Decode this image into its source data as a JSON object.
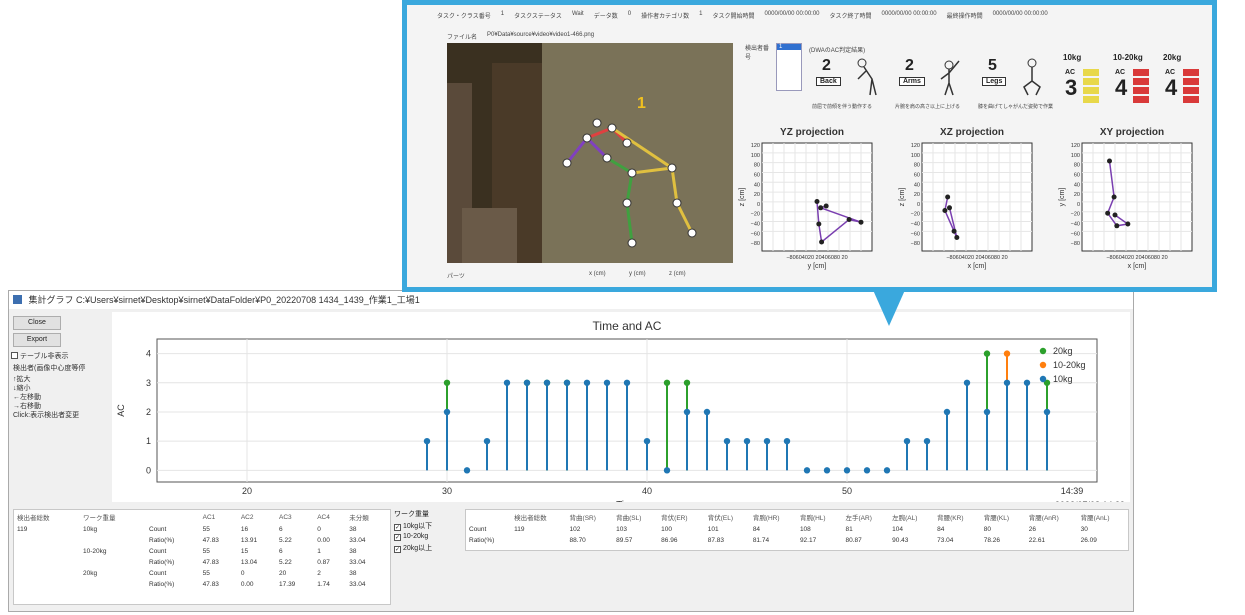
{
  "window": {
    "title": "集計グラフ C:¥Users¥sirnet¥Desktop¥sirnet¥DataFolder¥P0_20220708 1434_1439_作業1_工場1"
  },
  "sidebar": {
    "close_label": "Close",
    "export_label": "Export",
    "table_toggle_label": "テーブル非表示",
    "options_title": "検出者(画像中心度等停",
    "opt_zoom_in": "↑拡大",
    "opt_zoom_out": "↓縮小",
    "opt_move_left": "←左移動",
    "opt_move_right": "→右移動",
    "opt_click": "Click:表示検出者変更"
  },
  "chart_data": {
    "type": "scatter",
    "title": "Time and AC",
    "xlabel": "Time",
    "ylabel": "AC",
    "xlim": [
      15.5,
      62.5
    ],
    "ylim": [
      -0.4,
      4.5
    ],
    "xticks": [
      20,
      30,
      40,
      50
    ],
    "yticks": [
      0,
      1,
      2,
      3,
      4
    ],
    "extra_xtick_label": "14:39",
    "date_label": "2022/07/08 14:39",
    "legend_position": "top-right",
    "series": [
      {
        "name": "20kg",
        "color": "#2ca02c",
        "x": [
          30,
          34,
          35,
          36,
          41,
          42,
          57,
          60
        ],
        "y": [
          3,
          3,
          3,
          3,
          3,
          3,
          4,
          3
        ]
      },
      {
        "name": "10-20kg",
        "color": "#ff7f0e",
        "x": [
          58
        ],
        "y": [
          4
        ]
      },
      {
        "name": "10kg",
        "color": "#1f77b4",
        "x": [
          29,
          30,
          31,
          32,
          33,
          34,
          35,
          36,
          37,
          38,
          39,
          40,
          41,
          42,
          43,
          44,
          45,
          46,
          47,
          48,
          49,
          50,
          51,
          52,
          53,
          54,
          55,
          56,
          57,
          58,
          59,
          60
        ],
        "y": [
          1,
          2,
          0,
          1,
          3,
          3,
          3,
          3,
          3,
          3,
          3,
          1,
          0,
          2,
          2,
          1,
          1,
          1,
          1,
          0,
          0,
          0,
          0,
          0,
          1,
          1,
          2,
          3,
          2,
          3,
          3,
          2
        ]
      }
    ]
  },
  "stats_table": {
    "headers": [
      "検出者総数",
      "ワーク重量",
      "",
      "AC1",
      "AC2",
      "AC3",
      "AC4",
      "未分類"
    ],
    "rows": [
      [
        "119",
        "10kg",
        "Count",
        "55",
        "16",
        "6",
        "0",
        "38"
      ],
      [
        "",
        "",
        "Ratio(%)",
        "47.83",
        "13.91",
        "5.22",
        "0.00",
        "33.04"
      ],
      [
        "",
        "10-20kg",
        "Count",
        "55",
        "15",
        "6",
        "1",
        "38"
      ],
      [
        "",
        "",
        "Ratio(%)",
        "47.83",
        "13.04",
        "5.22",
        "0.87",
        "33.04"
      ],
      [
        "",
        "20kg",
        "Count",
        "55",
        "0",
        "20",
        "2",
        "38"
      ],
      [
        "",
        "",
        "Ratio(%)",
        "47.83",
        "0.00",
        "17.39",
        "1.74",
        "33.04"
      ]
    ]
  },
  "weight_filter": {
    "title": "ワーク重量",
    "options": [
      "10kg以下",
      "10-20kg",
      "20kg以上"
    ]
  },
  "posture_table": {
    "headers": [
      "",
      "検出者総数",
      "背曲(SR)",
      "背曲(SL)",
      "背伏(ER)",
      "背伏(EL)",
      "背腕(HR)",
      "背腕(HL)",
      "左手(AR)",
      "左腕(AL)",
      "背腰(KR)",
      "背腰(KL)",
      "背腰(AnR)",
      "背腰(AnL)"
    ],
    "rows": [
      [
        "Count",
        "119",
        "102",
        "103",
        "100",
        "101",
        "84",
        "108",
        "81",
        "104",
        "84",
        "80",
        "26",
        "30"
      ],
      [
        "Ratio(%)",
        "",
        "88.70",
        "89.57",
        "86.96",
        "87.83",
        "81.74",
        "92.17",
        "80.87",
        "90.43",
        "73.04",
        "78.26",
        "22.61",
        "26.09"
      ]
    ]
  },
  "inset": {
    "header": [
      "タスク・クラス番号",
      "1",
      "タスクステータス",
      "Wait",
      "データ数",
      "0",
      "操作者カテゴリ数",
      "1",
      "タスク開始時間",
      "0000/00/00 00:00:00",
      "タスク終了時間",
      "0000/00/00 00:00:00",
      "最終操作時間",
      "0000/00/00 00:00:00"
    ],
    "file_label": "ファイル名",
    "file_value": "P0¥Data¥source¥video¥video1-466.png",
    "detector_label": "検出者番号",
    "detector_id": "1",
    "person_number": "1",
    "ac_title": "(DWAのAC判定結果)",
    "back_score": "2",
    "back_label": "Back",
    "back_desc": "前屈で前傾を伴う動作する",
    "arms_score": "2",
    "arms_label": "Arms",
    "arms_desc": "片腕を肩の高さ以上に上げる",
    "legs_score": "5",
    "legs_label": "Legs",
    "legs_desc": "膝を曲げてしゃがんだ姿勢で作業",
    "weights": [
      {
        "label": "10kg",
        "ac_label": "AC",
        "value": "3",
        "color": "#e8d84a"
      },
      {
        "label": "10-20kg",
        "ac_label": "AC",
        "value": "4",
        "color": "#d93a3a"
      },
      {
        "label": "20kg",
        "ac_label": "AC",
        "value": "4",
        "color": "#d93a3a"
      }
    ],
    "projections": [
      {
        "title": "YZ projection",
        "xlabel": "y [cm]",
        "ylabel": "z [cm]"
      },
      {
        "title": "XZ projection",
        "xlabel": "x [cm]",
        "ylabel": "z [cm]"
      },
      {
        "title": "XY projection",
        "xlabel": "x [cm]",
        "ylabel": "y [cm]"
      }
    ],
    "proj_yticks": [
      "120",
      "100",
      "80",
      "60",
      "40",
      "20",
      "0",
      "−20",
      "−40",
      "−60",
      "−80"
    ],
    "proj_xtick_text": "−80604020 20406080 20",
    "footer_label": "パーツ",
    "footer_cols": [
      "x (cm)",
      "y (cm)",
      "z (cm)"
    ]
  }
}
